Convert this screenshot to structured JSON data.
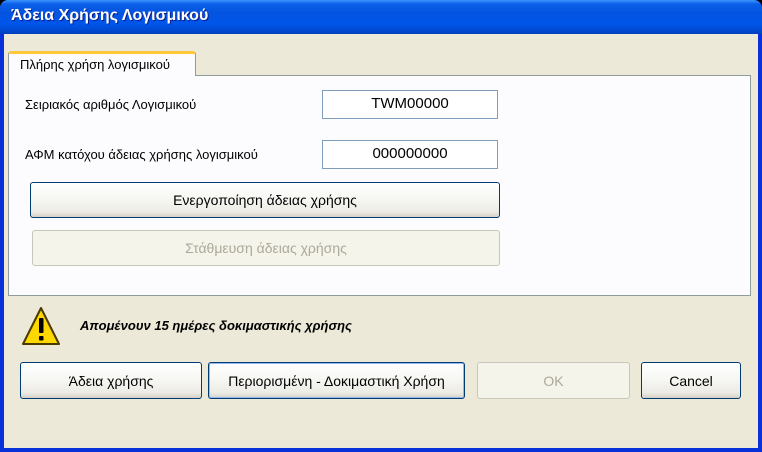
{
  "window": {
    "title": "Άδεια Χρήσης Λογισμικού"
  },
  "tab": {
    "label": "Πλήρης χρήση λογισμικού"
  },
  "form": {
    "serial_label": "Σειριακός αριθμός Λογισμικού",
    "serial_value": "TWM00000",
    "afm_label": "ΑΦΜ κατόχου άδειας χρήσης λογισμικού",
    "afm_value": "000000000",
    "activate_label": "Ενεργοποίηση άδειας χρήσης",
    "park_label": "Στάθμευση άδειας χρήσης"
  },
  "status": {
    "icon": "warning-icon",
    "message": "Απομένουν 15 ημέρες δοκιμαστικής χρήσης"
  },
  "buttons": {
    "license_label": "Άδεια χρήσης",
    "trial_label": "Περιορισμένη - Δοκιμαστική Χρήση",
    "ok_label": "OK",
    "cancel_label": "Cancel"
  },
  "colors": {
    "titlebar": "#0055ea",
    "tab_highlight": "#ffc83c",
    "dialog_bg": "#ece9d8",
    "warning": "#ffd800"
  }
}
